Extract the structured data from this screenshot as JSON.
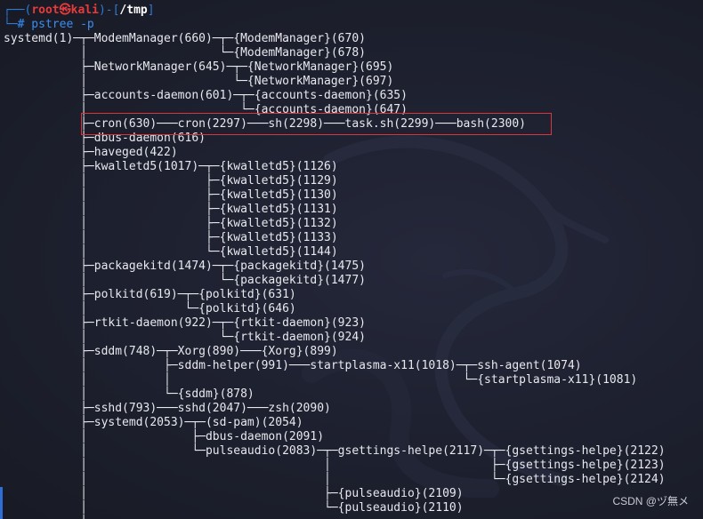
{
  "prompt": {
    "frame_top": "┌──(",
    "user": "root㉿kali",
    "frame_mid": ")-[",
    "path": "/tmp",
    "frame_end": "]",
    "frame_bottom": "└─",
    "hash": "#",
    "command": " pstree -p"
  },
  "tree_lines": [
    "systemd(1)─┬─ModemManager(660)─┬─{ModemManager}(670)",
    "           │                   └─{ModemManager}(678)",
    "           ├─NetworkManager(645)─┬─{NetworkManager}(695)",
    "           │                     └─{NetworkManager}(697)",
    "           ├─accounts-daemon(601)─┬─{accounts-daemon}(635)",
    "           │                      └─{accounts-daemon}(647)",
    "           ├─cron(630)───cron(2297)───sh(2298)───task.sh(2299)───bash(2300)",
    "           ├─dbus-daemon(616)",
    "           ├─haveged(422)",
    "           ├─kwalletd5(1017)─┬─{kwalletd5}(1126)",
    "           │                 ├─{kwalletd5}(1129)",
    "           │                 ├─{kwalletd5}(1130)",
    "           │                 ├─{kwalletd5}(1131)",
    "           │                 ├─{kwalletd5}(1132)",
    "           │                 ├─{kwalletd5}(1133)",
    "           │                 └─{kwalletd5}(1144)",
    "           ├─packagekitd(1474)─┬─{packagekitd}(1475)",
    "           │                   └─{packagekitd}(1477)",
    "           ├─polkitd(619)─┬─{polkitd}(631)",
    "           │              └─{polkitd}(646)",
    "           ├─rtkit-daemon(922)─┬─{rtkit-daemon}(923)",
    "           │                   └─{rtkit-daemon}(924)",
    "           ├─sddm(748)─┬─Xorg(890)───{Xorg}(899)",
    "           │           ├─sddm-helper(991)───startplasma-x11(1018)─┬─ssh-agent(1074)",
    "           │           │                                          └─{startplasma-x11}(1081)",
    "           │           └─{sddm}(878)",
    "           ├─sshd(793)───sshd(2047)───zsh(2090)",
    "           ├─systemd(2053)─┬─(sd-pam)(2054)",
    "           │               ├─dbus-daemon(2091)",
    "           │               └─pulseaudio(2083)─┬─gsettings-helpe(2117)─┬─{gsettings-helpe}(2122)",
    "           │                                  │                       ├─{gsettings-helpe}(2123)",
    "           │                                  │                       └─{gsettings-helpe}(2124)",
    "           │                                  ├─{pulseaudio}(2109)",
    "           │                                  └─{pulseaudio}(2110)",
    "           │"
  ],
  "watermark": "CSDN @ヅ無メ",
  "colors": {
    "background": "#1b1d29",
    "text": "#e8e8ee",
    "prompt_frame": "#2e7bd6",
    "prompt_user": "#e63b3b",
    "command": "#3b8ef0",
    "highlight_border": "#d8363a"
  }
}
